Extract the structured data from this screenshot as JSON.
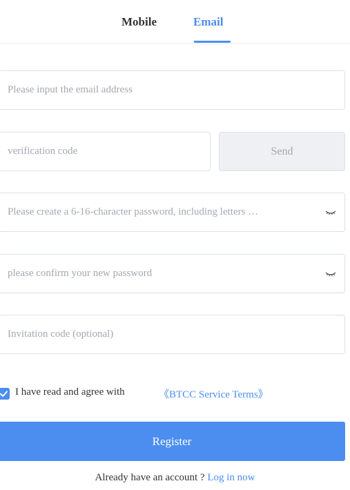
{
  "tabs": {
    "mobile": "Mobile",
    "email": "Email",
    "active": "Email"
  },
  "form": {
    "email_placeholder": "Please input the email address",
    "code_placeholder": "verification code",
    "send_label": "Send",
    "password_placeholder": "Please create a 6-16-character password, including letters …",
    "confirm_placeholder": "please confirm your new password",
    "invite_placeholder": "Invitation code (optional)",
    "eye_icon": "eye-closed-icon"
  },
  "agreement": {
    "checked": true,
    "text": "I have read and agree with",
    "link": "《BTCC Service Terms》"
  },
  "register_label": "Register",
  "login": {
    "question": "Already have an account ?",
    "link": "Log in now"
  },
  "colors": {
    "accent": "#4c8df0",
    "border": "#dde1e6",
    "placeholder": "#a3a8b0",
    "send_bg": "#eef0f3"
  }
}
